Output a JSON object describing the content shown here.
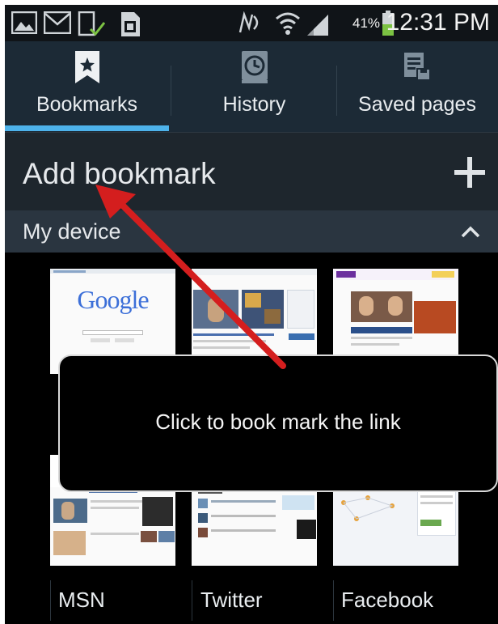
{
  "status_bar": {
    "time": "12:31 PM",
    "battery_percent": "41%",
    "icons": [
      "image-icon",
      "mail-icon",
      "download-check-icon",
      "sim-card-icon",
      "nfc-icon",
      "wifi-icon",
      "signal-icon",
      "battery-icon"
    ]
  },
  "tabs": [
    {
      "label": "Bookmarks",
      "icon": "bookmark-star-icon",
      "selected": true
    },
    {
      "label": "History",
      "icon": "clock-icon",
      "selected": false
    },
    {
      "label": "Saved pages",
      "icon": "saved-page-icon",
      "selected": false
    }
  ],
  "add_bookmark": {
    "label": "Add bookmark",
    "icon": "plus-icon"
  },
  "folder": {
    "label": "My device",
    "icon": "chevron-up-icon"
  },
  "bookmarks": [
    {
      "label": "MSN"
    },
    {
      "label": "Twitter"
    },
    {
      "label": "Facebook"
    }
  ],
  "thumbnail_text": {
    "google_logo": "Google"
  },
  "callout": {
    "text": "Click to book mark the link"
  },
  "colors": {
    "accent": "#4db2ea",
    "tabbar_bg": "#1c2a36",
    "arrow": "#d41e1e"
  }
}
